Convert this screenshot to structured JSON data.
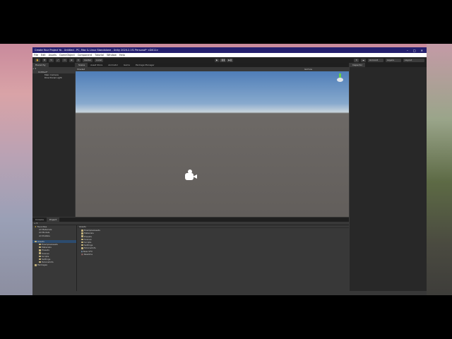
{
  "window": {
    "title": "Create Your Project Yo - Untitled - PC, Mac & Linux Standalone - Unity 2020.2.1f1 Personal* <DX11>",
    "controls": [
      "–",
      "□",
      "✕"
    ]
  },
  "menu": [
    "File",
    "Edit",
    "Assets",
    "GameObject",
    "Component",
    "Tutorial",
    "Window",
    "Help"
  ],
  "toolbar": {
    "pivot": "Center",
    "space": "Local",
    "account": "Account",
    "layers": "Layers",
    "layout": "Layout"
  },
  "hierarchy": {
    "tab": "Hierarchy",
    "items": [
      "Untitled*",
      "Main Camera",
      "Directional Light"
    ]
  },
  "scene": {
    "tabs": [
      "Scene",
      "Asset Store",
      "Animator",
      "Game",
      "Package Manager"
    ],
    "shading": "Shaded",
    "gizmos": "Gizmos",
    "persp": "< Persp"
  },
  "inspector": {
    "tab": "Inspector"
  },
  "bottom": {
    "tabs": [
      "Console",
      "Project"
    ],
    "favorites": "Favorites",
    "fav_items": [
      "All Materials",
      "All Models",
      "All Prefabs"
    ],
    "assets": "Assets",
    "asset_tree": [
      "ExampleAssets",
      "Materials",
      "Presets",
      "Scenes",
      "Scripts",
      "Settings",
      "TutorialInfo"
    ],
    "packages": "Packages",
    "breadcrumb": "Assets",
    "files": [
      "ExampleAssets",
      "Materials",
      "Presets",
      "Scenes",
      "Scripts",
      "Settings",
      "TutorialInfo",
      "New VFX",
      "Readme"
    ]
  }
}
